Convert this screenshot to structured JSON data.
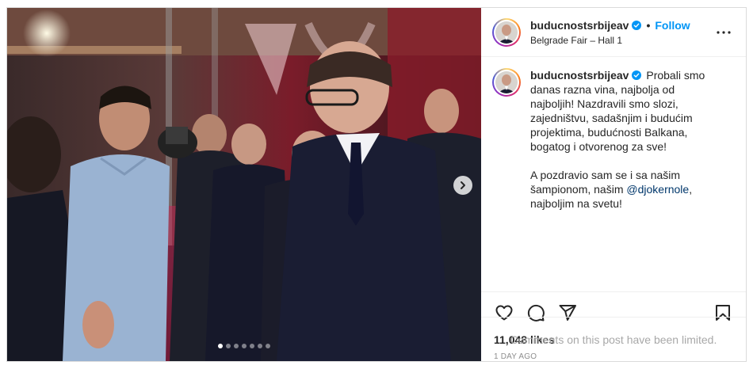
{
  "post": {
    "username": "buducnostsrbijeav",
    "follow_label": "Follow",
    "separator": "•",
    "location": "Belgrade Fair – Hall 1",
    "caption": {
      "paragraph1": "Probali smo danas razna vina, najbolja od najboljih! Nazdravili smo slozi, zajedništvu, sadašnjim i budućim projektima, budućnosti Balkana, bogatog i otvorenog za sve!",
      "paragraph2_before": "A pozdravio sam se i sa našim šampionom, našim ",
      "mention": "@djokernole",
      "paragraph2_after": ", najboljim na svetu!"
    },
    "likes": "11,048 likes",
    "time": "1 DAY AGO",
    "comments_note": "Comments on this post have been limited.",
    "carousel": {
      "slide_count": 7,
      "active_index": 0
    }
  },
  "colors": {
    "accent": "#0095f6",
    "mention": "#00376b",
    "muted": "#8e8e8e"
  },
  "icons": [
    "verified-badge-icon",
    "more-options-icon",
    "heart-icon",
    "comment-icon",
    "share-icon",
    "bookmark-icon",
    "chevron-right-icon"
  ]
}
